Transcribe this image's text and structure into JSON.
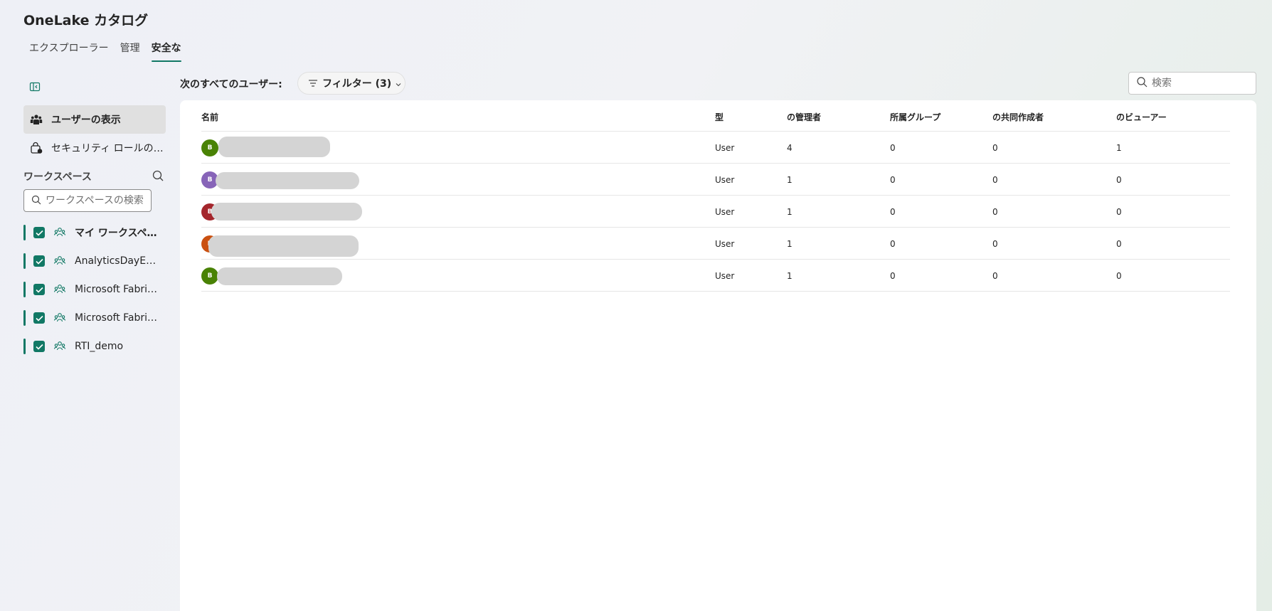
{
  "app": {
    "title": "OneLake カタログ"
  },
  "tabs": [
    {
      "label": "エクスプローラー"
    },
    {
      "label": "管理"
    },
    {
      "label": "安全な"
    }
  ],
  "sidebar": {
    "nav": [
      {
        "label": "ユーザーの表示",
        "icon": "people-icon",
        "selected": true
      },
      {
        "label": "セキュリティ ロールの表示",
        "icon": "shield-lock-icon",
        "selected": false
      }
    ],
    "workspaces_header": "ワークスペース",
    "workspace_search_placeholder": "ワークスペースの検索",
    "workspaces": [
      {
        "label": "マイ ワークスペース",
        "checked": true
      },
      {
        "label": "AnalyticsDayEnooo",
        "checked": true
      },
      {
        "label": "Microsoft Fabric Demo",
        "checked": true
      },
      {
        "label": "Microsoft Fabric Lab",
        "checked": true
      },
      {
        "label": "RTI_demo",
        "checked": true
      }
    ]
  },
  "toolbar": {
    "users_label": "次のすべてのユーザー:",
    "filter_label": "フィルター (3)",
    "search_placeholder": "検索"
  },
  "table": {
    "columns": [
      "名前",
      "型",
      "の管理者",
      "所属グループ",
      "の共同作成者",
      "のビューアー"
    ],
    "rows": [
      {
        "initial": "B",
        "avatar_color": "#498205",
        "type": "User",
        "admin": "4",
        "member": "0",
        "contributor": "0",
        "viewer": "1"
      },
      {
        "initial": "B",
        "avatar_color": "#8764b8",
        "type": "User",
        "admin": "1",
        "member": "0",
        "contributor": "0",
        "viewer": "0"
      },
      {
        "initial": "B",
        "avatar_color": "#a4262c",
        "type": "User",
        "admin": "1",
        "member": "0",
        "contributor": "0",
        "viewer": "0"
      },
      {
        "initial": "B",
        "avatar_color": "#ca5010",
        "type": "User",
        "admin": "1",
        "member": "0",
        "contributor": "0",
        "viewer": "0"
      },
      {
        "initial": "B",
        "avatar_color": "#498205",
        "type": "User",
        "admin": "1",
        "member": "0",
        "contributor": "0",
        "viewer": "0"
      }
    ]
  },
  "colors": {
    "accent": "#117865"
  }
}
